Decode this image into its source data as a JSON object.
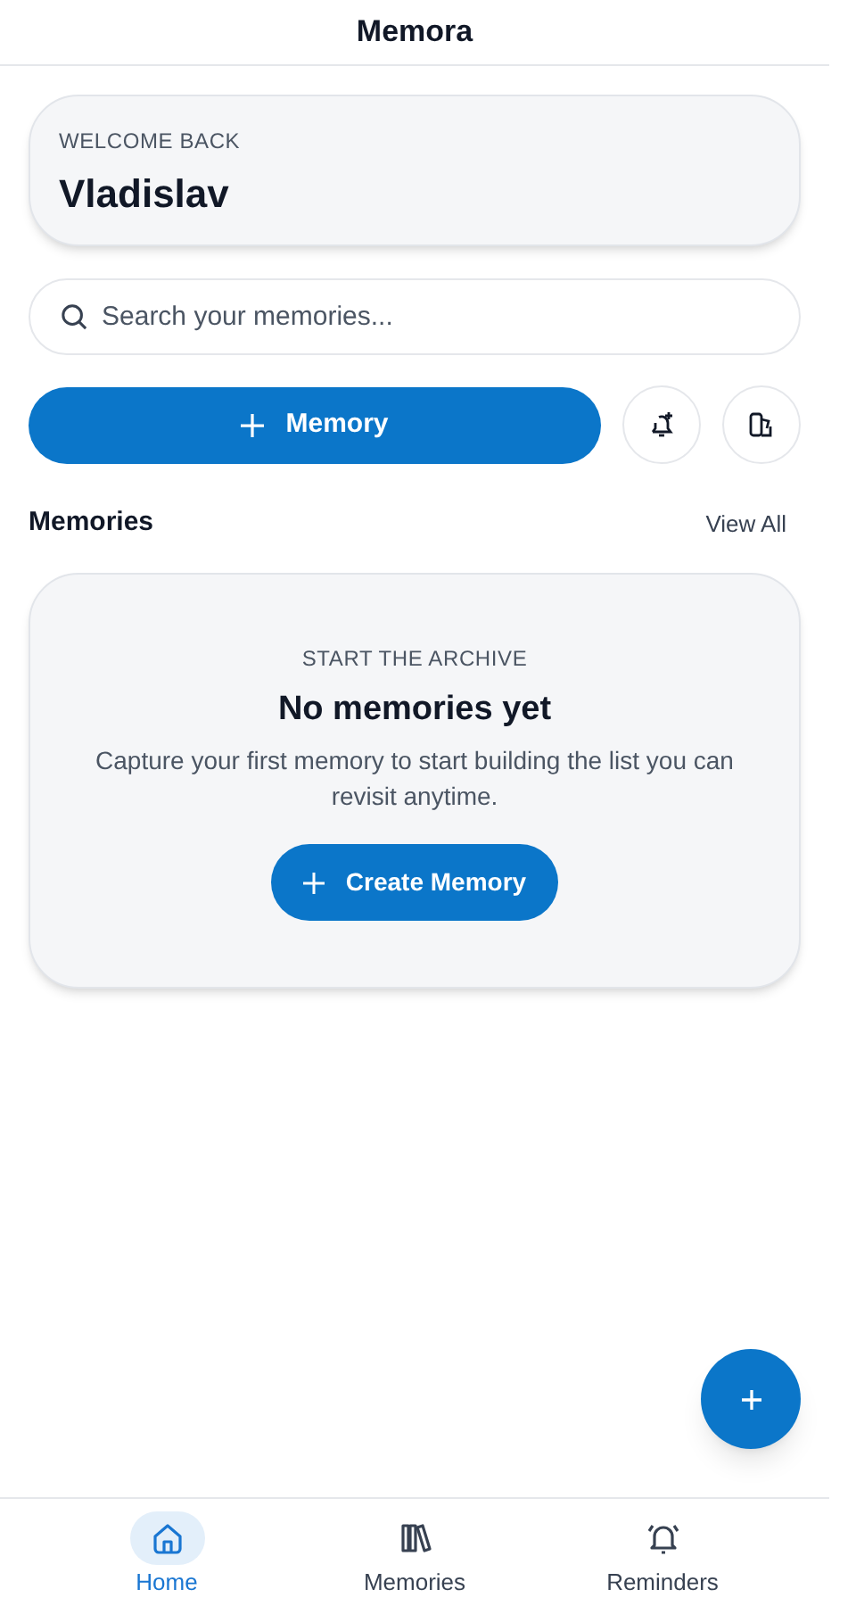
{
  "app_bar": {
    "title": "Memora"
  },
  "welcome": {
    "eyebrow": "WELCOME BACK",
    "name": "Vladislav"
  },
  "search": {
    "placeholder": "Search your memories..."
  },
  "actions": {
    "primary": "Memory"
  },
  "section": {
    "title": "Memories",
    "link": "View All"
  },
  "empty_state": {
    "eyebrow": "START THE ARCHIVE",
    "title": "No memories yet",
    "message": "Capture your first memory to start building the list you can revisit anytime.",
    "button": "Create Memory"
  },
  "bottom_nav": [
    {
      "label": "Home",
      "kind": "home",
      "selected": true
    },
    {
      "label": "Memories",
      "kind": "books",
      "selected": false
    },
    {
      "label": "Reminders",
      "kind": "bell",
      "selected": false
    }
  ]
}
